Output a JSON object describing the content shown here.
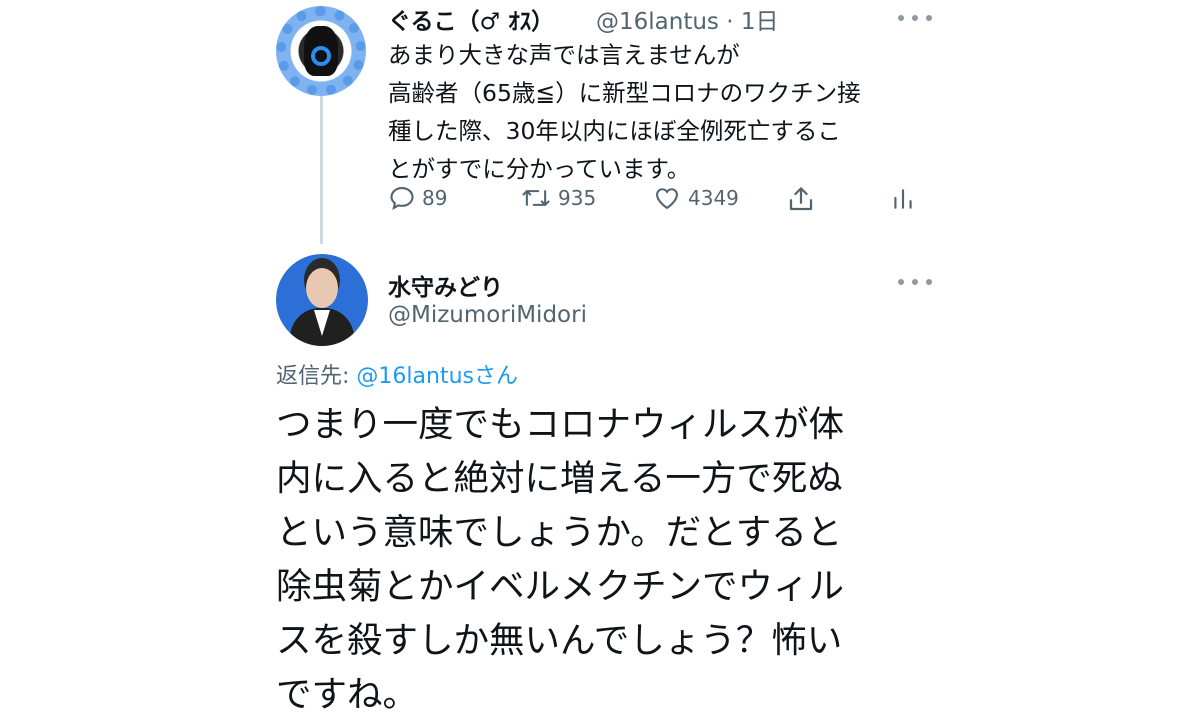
{
  "tweet1": {
    "name": "ぐるこ（♂ ｵｽ）",
    "handle": "@16lantus · 1日",
    "lines": [
      "あまり大きな声では言えませんが",
      "高齢者（65歳≦）に新型コロナのワクチン接",
      "種した際、30年以内にほぼ全例死亡するこ",
      "とがすでに分かっています。"
    ],
    "replies": "89",
    "retweets": "935",
    "likes": "4349",
    "icons": [
      "more-icon",
      "reply-icon",
      "retweet-icon",
      "like-icon",
      "share-icon",
      "analytics-icon"
    ]
  },
  "tweet2": {
    "name": "水守みどり",
    "handle": "@MizumoriMidori",
    "reply_label": "返信先: ",
    "reply_mention": "@16lantusさん",
    "lines": [
      "つまり一度でもコロナウィルスが体",
      "内に入ると絶対に増える一方で死ぬ",
      "という意味でしょうか。だとすると",
      "除虫菊とかイベルメクチンでウィル",
      "スを殺すしか無いんでしょう？怖い",
      "ですね。"
    ]
  },
  "colors": {
    "text": "#0f1419",
    "secondary": "#536471",
    "link": "#1d9bf0",
    "thread_line": "#cfd9de"
  }
}
